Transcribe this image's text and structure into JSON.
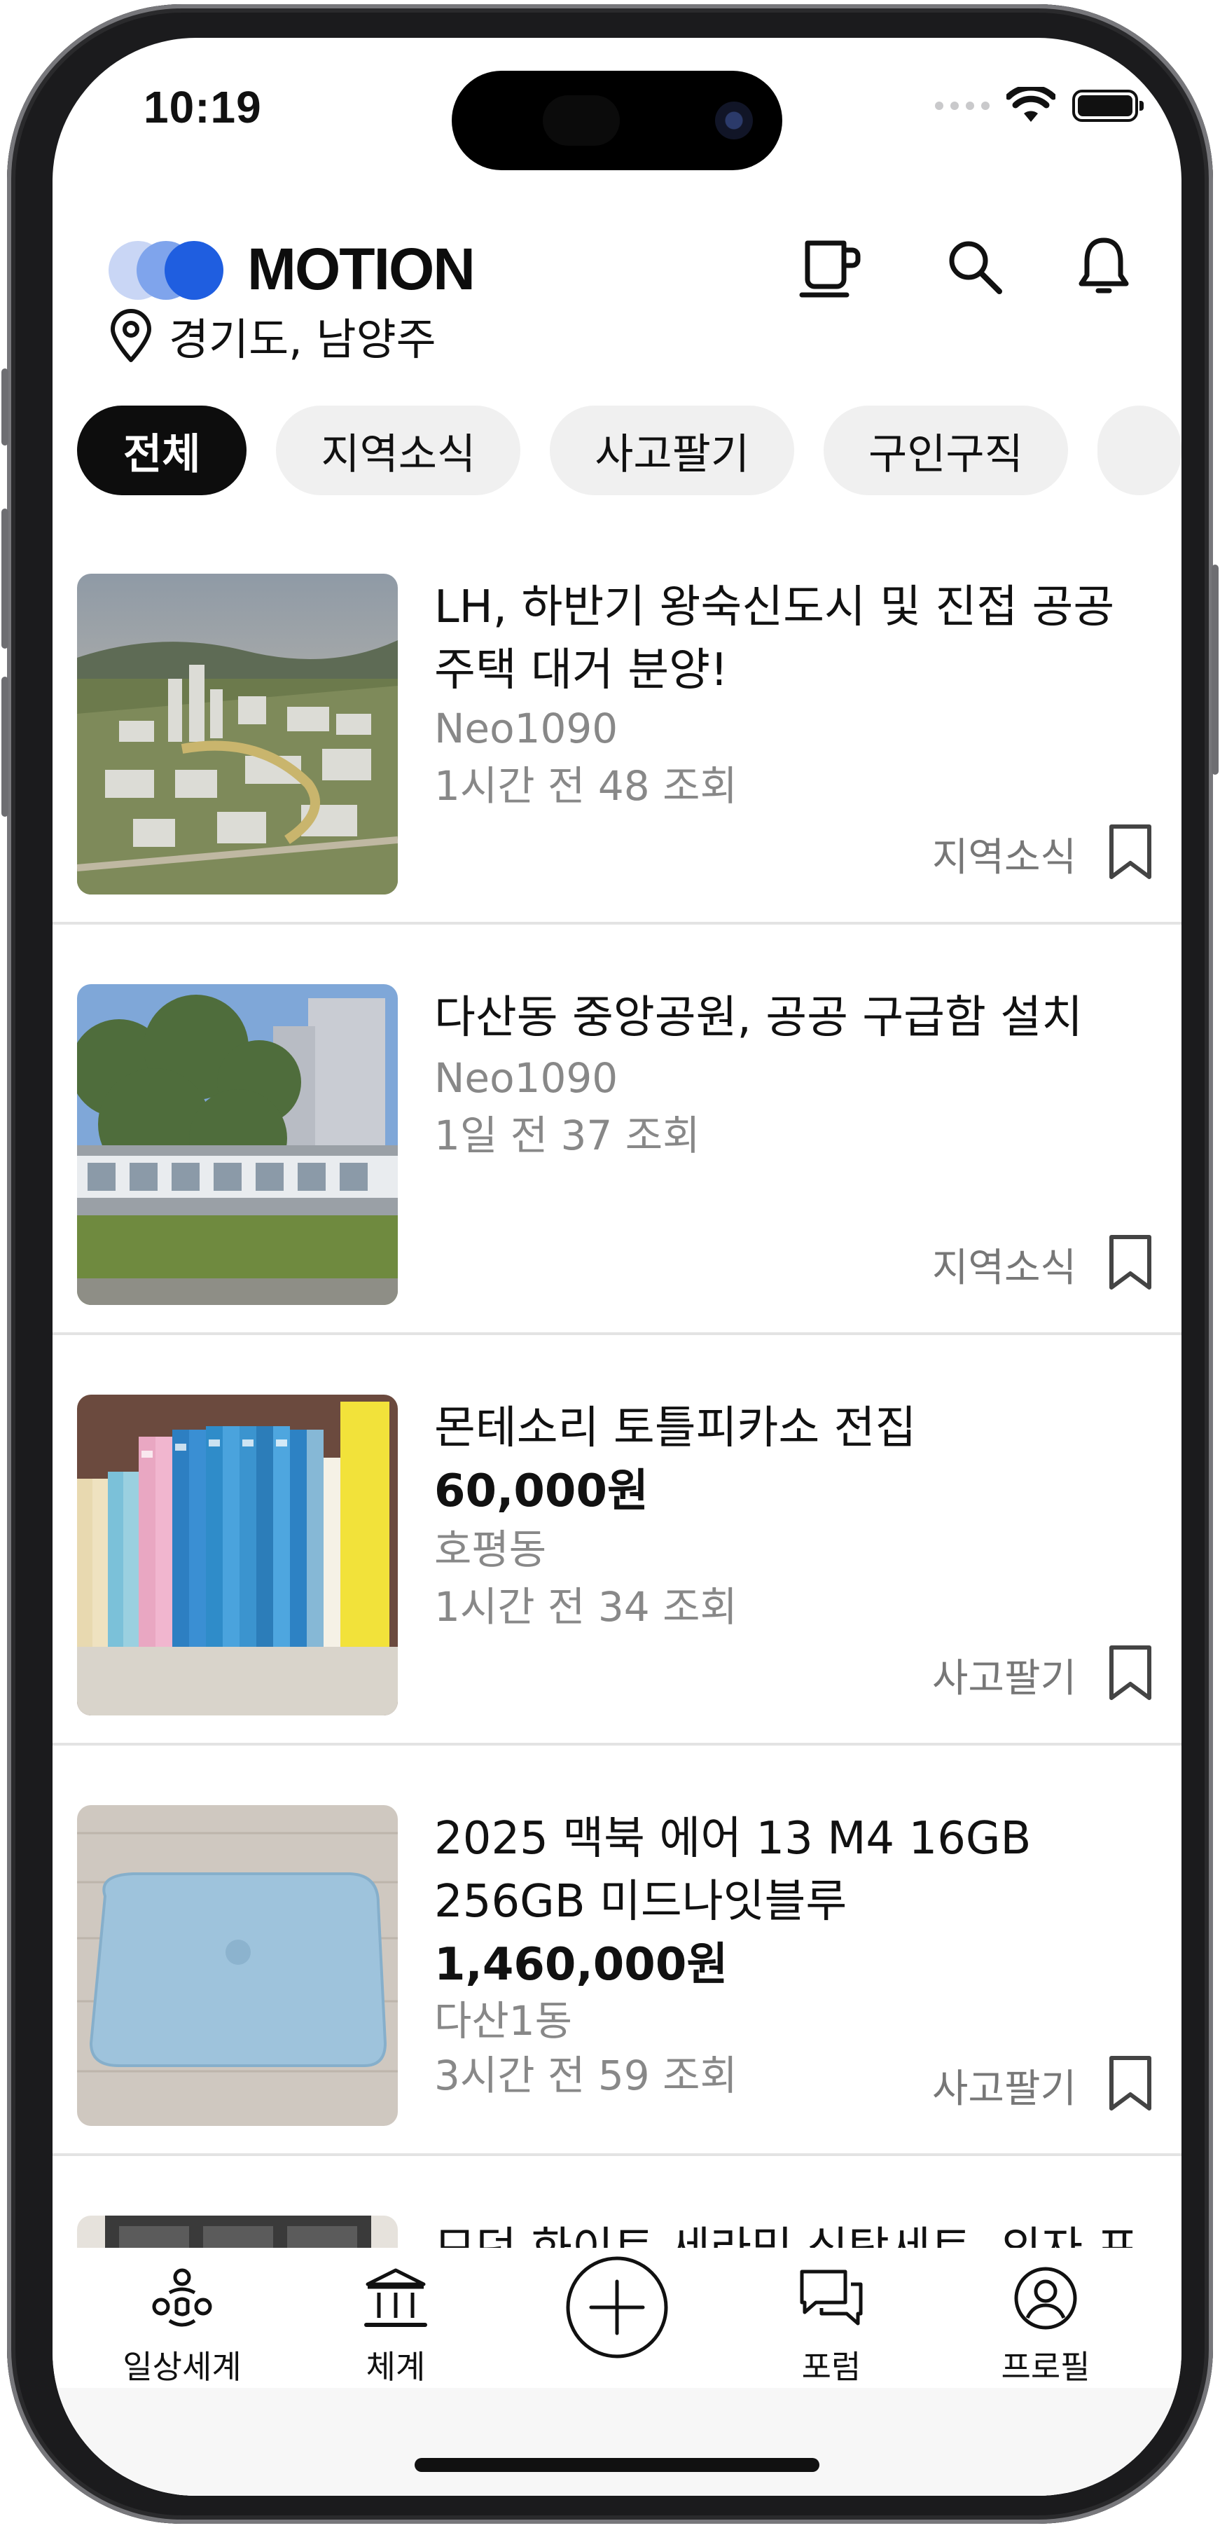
{
  "status_bar": {
    "time": "10:19"
  },
  "header": {
    "logo_text": "MOTION",
    "logo_colors": [
      "#c9d6f5",
      "#7fa4ec",
      "#1f5ee0"
    ],
    "icons": [
      "cup-icon",
      "search-icon",
      "bell-icon"
    ]
  },
  "location": {
    "text": "경기도, 남양주"
  },
  "chips": [
    "전체",
    "지역소식",
    "사고팔기",
    "구인구직"
  ],
  "posts": [
    {
      "title": "LH, 하반기 왕숙신도시 및 진접 공공 주택 대거 분양!",
      "author": "Neo1090",
      "meta": "1시간 전  48 조회",
      "category": "지역소식",
      "thumb": "city-aerial-rendering"
    },
    {
      "title": "다산동 중앙공원, 공공 구급함 설치",
      "author": "Neo1090",
      "meta": "1일 전  37 조회",
      "category": "지역소식",
      "thumb": "park-sign-photo"
    },
    {
      "title": "몬테소리 토틀피카소 전집",
      "price": "60,000원",
      "author": "호평동",
      "meta": "1시간 전  34 조회",
      "category": "사고팔기",
      "thumb": "book-set-photo"
    },
    {
      "title": "2025 맥북 에어 13 M4 16GB 256GB 미드나잇블루",
      "price": "1,460,000원",
      "author": "다산1동",
      "meta": "3시간 전  59 조회",
      "category": "사고팔기",
      "thumb": "laptop-photo"
    },
    {
      "title": "모던 화이트 세라믹 식탁세트, 의자 포",
      "thumb": "dining-set-photo"
    }
  ],
  "tabbar": {
    "items": [
      {
        "label": "일상세계",
        "icon": "community-icon"
      },
      {
        "label": "체계",
        "icon": "institution-icon"
      },
      {
        "label": "",
        "icon": "add-circle-icon"
      },
      {
        "label": "포럼",
        "icon": "chat-bubbles-icon"
      },
      {
        "label": "프로필",
        "icon": "profile-icon"
      }
    ]
  }
}
